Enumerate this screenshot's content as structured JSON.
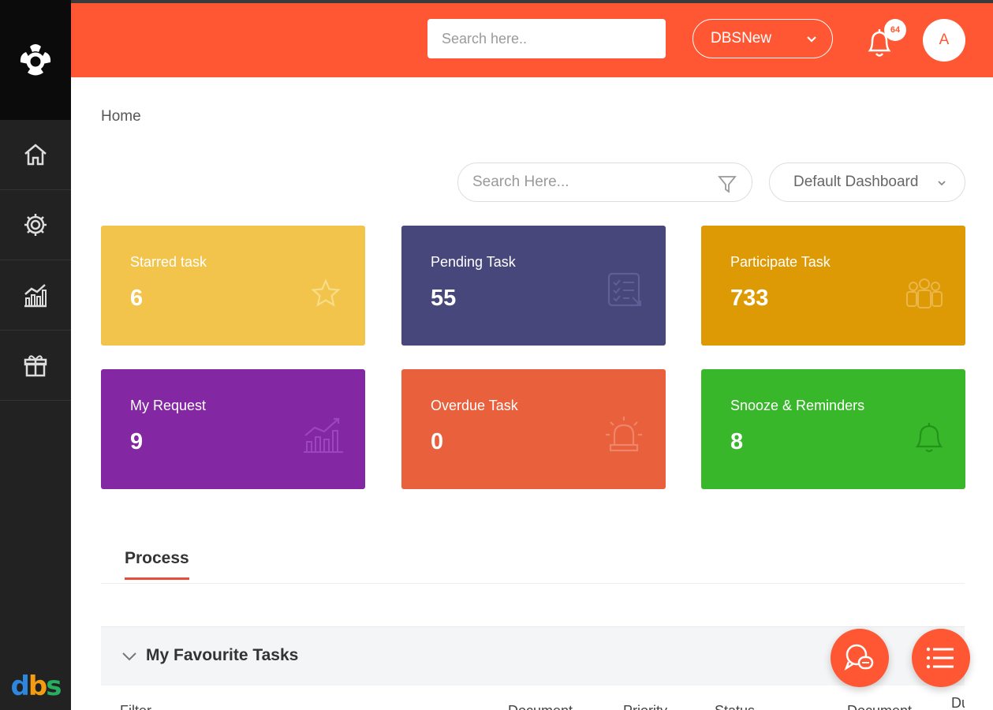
{
  "topbar": {
    "search_placeholder": "Search here..",
    "org_select": "DBSNew",
    "notification_count": "64",
    "avatar_initial": "A",
    "color": "#ff5733"
  },
  "sidebar": {
    "items": [
      {
        "icon": "home-icon"
      },
      {
        "icon": "gear-icon"
      },
      {
        "icon": "chart-icon"
      },
      {
        "icon": "gift-icon"
      }
    ],
    "brand": [
      "d",
      "b",
      "s"
    ]
  },
  "breadcrumb": "Home",
  "toolbar": {
    "search_placeholder": "Search Here...",
    "dashboard_select": "Default Dashboard"
  },
  "cards": [
    {
      "label": "Starred task",
      "value": "6",
      "icon": "star-icon",
      "color": "#f2c44c"
    },
    {
      "label": "Pending Task",
      "value": "55",
      "icon": "checklist-icon",
      "color": "#47477b"
    },
    {
      "label": "Participate Task",
      "value": "733",
      "icon": "group-icon",
      "color": "#de9a04"
    },
    {
      "label": "My Request",
      "value": "9",
      "icon": "growth-chart-icon",
      "color": "#8427a2"
    },
    {
      "label": "Overdue Task",
      "value": "0",
      "icon": "siren-icon",
      "color": "#e8603c"
    },
    {
      "label": "Snooze & Reminders",
      "value": "8",
      "icon": "bell-icon",
      "color": "#38b72b"
    }
  ],
  "tabs": [
    {
      "label": "Process"
    }
  ],
  "favourites": {
    "title": "My Favourite Tasks",
    "columns": [
      "Filter",
      "Document",
      "Priority",
      "Status",
      "Document",
      "Du"
    ]
  },
  "fabs": [
    {
      "icon": "chat-icon"
    },
    {
      "icon": "menu-icon"
    }
  ]
}
